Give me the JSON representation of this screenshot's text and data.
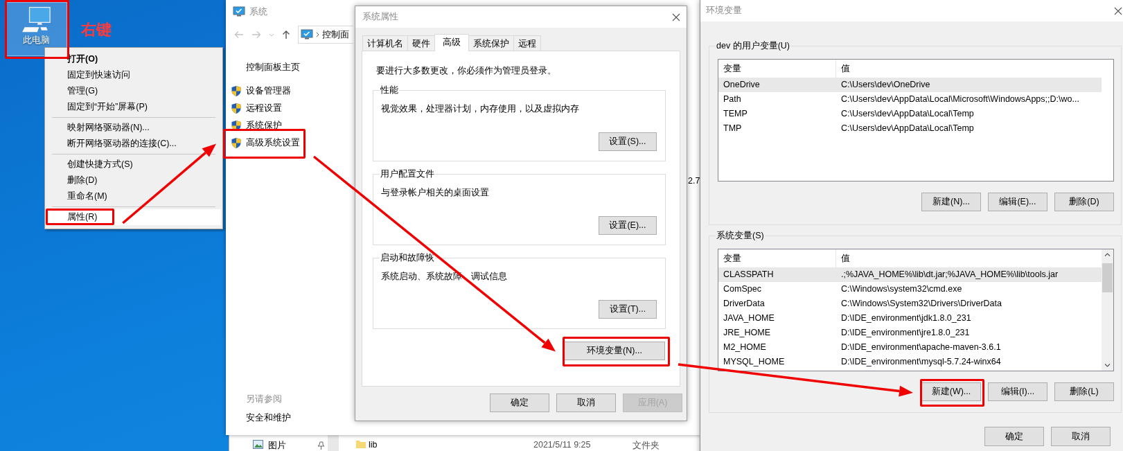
{
  "desktop": {
    "icon_label": "此电脑",
    "highlighted": true,
    "annotation": "右键"
  },
  "context_menu": {
    "groups": [
      {
        "items": [
          {
            "label": "打开(O)",
            "kind": "default",
            "selected": false,
            "highlighted": false
          },
          {
            "label": "固定到快速访问",
            "kind": "normal",
            "selected": false,
            "highlighted": false
          },
          {
            "label": "管理(G)",
            "kind": "normal",
            "selected": false,
            "highlighted": false
          },
          {
            "label": "固定到“开始”屏幕(P)",
            "kind": "normal",
            "selected": false,
            "highlighted": false
          }
        ]
      },
      {
        "items": [
          {
            "label": "映射网络驱动器(N)...",
            "kind": "normal",
            "selected": false,
            "highlighted": false
          },
          {
            "label": "断开网络驱动器的连接(C)...",
            "kind": "normal",
            "selected": false,
            "highlighted": false
          }
        ]
      },
      {
        "items": [
          {
            "label": "创建快捷方式(S)",
            "kind": "normal",
            "selected": false,
            "highlighted": false
          },
          {
            "label": "删除(D)",
            "kind": "normal",
            "selected": false,
            "highlighted": false
          },
          {
            "label": "重命名(M)",
            "kind": "normal",
            "selected": false,
            "highlighted": false
          }
        ]
      },
      {
        "items": [
          {
            "label": "属性(R)",
            "kind": "normal",
            "selected": true,
            "highlighted": true
          }
        ]
      }
    ]
  },
  "system_window": {
    "title": "系统",
    "address": "控制面",
    "home_link": "控制面板主页",
    "tasks": [
      {
        "label": "设备管理器",
        "highlighted": false
      },
      {
        "label": "远程设置",
        "highlighted": false
      },
      {
        "label": "系统保护",
        "highlighted": false
      },
      {
        "label": "高级系统设置",
        "highlighted": true
      }
    ],
    "see_also_heading": "另请参阅",
    "see_also": [
      "安全和维护"
    ],
    "content_fragment": "2.7"
  },
  "explorer_behind": {
    "nav_item": "图片",
    "file": {
      "name": "lib",
      "date": "2021/5/11 9:25",
      "type": "文件夹"
    }
  },
  "system_properties": {
    "title": "系统属性",
    "tabs": [
      {
        "label": "计算机名",
        "selected": false
      },
      {
        "label": "硬件",
        "selected": false
      },
      {
        "label": "高级",
        "selected": true
      },
      {
        "label": "系统保护",
        "selected": false
      },
      {
        "label": "远程",
        "selected": false
      }
    ],
    "notice": "要进行大多数更改，你必须作为管理员登录。",
    "groups": [
      {
        "title": "性能",
        "description": "视觉效果，处理器计划，内存使用，以及虚拟内存",
        "button": "设置(S)..."
      },
      {
        "title": "用户配置文件",
        "description": "与登录帐户相关的桌面设置",
        "button": "设置(E)..."
      },
      {
        "title": "启动和故障恢",
        "description": [
          "系统启动、系统故障",
          "调试信息"
        ],
        "button": "设置(T)..."
      }
    ],
    "env_button": {
      "label": "环境变量(N)...",
      "highlighted": true
    },
    "buttons": [
      {
        "label": "确定",
        "disabled": false
      },
      {
        "label": "取消",
        "disabled": false
      },
      {
        "label": "应用(A)",
        "disabled": true
      }
    ]
  },
  "env_vars": {
    "title": "环境变量",
    "user_group": {
      "title": "dev 的用户变量(U)",
      "columns": [
        "变量",
        "值"
      ],
      "scrollable": false,
      "rows": [
        {
          "name": "OneDrive",
          "value": "C:\\Users\\dev\\OneDrive",
          "selected": true
        },
        {
          "name": "Path",
          "value": "C:\\Users\\dev\\AppData\\Local\\Microsoft\\WindowsApps;;D:\\wo...",
          "selected": false
        },
        {
          "name": "TEMP",
          "value": "C:\\Users\\dev\\AppData\\Local\\Temp",
          "selected": false
        },
        {
          "name": "TMP",
          "value": "C:\\Users\\dev\\AppData\\Local\\Temp",
          "selected": false
        }
      ],
      "buttons": [
        {
          "label": "新建(N)...",
          "highlighted": false
        },
        {
          "label": "编辑(E)...",
          "highlighted": false
        },
        {
          "label": "删除(D)",
          "highlighted": false
        }
      ]
    },
    "system_group": {
      "title": "系统变量(S)",
      "columns": [
        "变量",
        "值"
      ],
      "scrollable": true,
      "rows": [
        {
          "name": "CLASSPATH",
          "value": ".;%JAVA_HOME%\\lib\\dt.jar;%JAVA_HOME%\\lib\\tools.jar",
          "selected": true
        },
        {
          "name": "ComSpec",
          "value": "C:\\Windows\\system32\\cmd.exe",
          "selected": false
        },
        {
          "name": "DriverData",
          "value": "C:\\Windows\\System32\\Drivers\\DriverData",
          "selected": false
        },
        {
          "name": "JAVA_HOME",
          "value": "D:\\IDE_environment\\jdk1.8.0_231",
          "selected": false
        },
        {
          "name": "JRE_HOME",
          "value": "D:\\IDE_environment\\jre1.8.0_231",
          "selected": false
        },
        {
          "name": "M2_HOME",
          "value": "D:\\IDE_environment\\apache-maven-3.6.1",
          "selected": false
        },
        {
          "name": "MYSQL_HOME",
          "value": "D:\\IDE_environment\\mysql-5.7.24-winx64",
          "selected": false
        }
      ],
      "buttons": [
        {
          "label": "新建(W)...",
          "highlighted": true
        },
        {
          "label": "编辑(I)...",
          "highlighted": false
        },
        {
          "label": "删除(L)",
          "highlighted": false
        }
      ]
    },
    "buttons": [
      "确定",
      "取消"
    ]
  }
}
